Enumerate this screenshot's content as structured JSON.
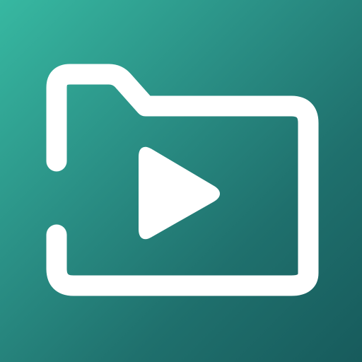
{
  "app_icon": {
    "icon": "video-folder-icon",
    "subicons": [
      "folder-icon",
      "play-icon"
    ],
    "colors": {
      "background_start": "#37b8a1",
      "background_end": "#175b5c",
      "glyph": "#ffffff"
    }
  }
}
